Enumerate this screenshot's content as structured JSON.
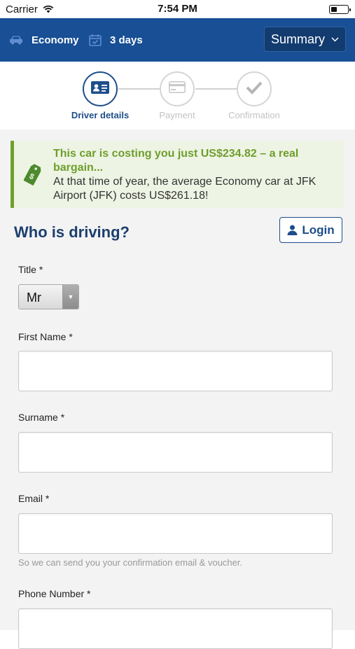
{
  "status_bar": {
    "carrier": "Carrier",
    "time": "7:54 PM"
  },
  "header": {
    "car_class": "Economy",
    "duration": "3 days",
    "summary_label": "Summary"
  },
  "steps": [
    {
      "label": "Driver details",
      "icon": "id-card-icon",
      "active": true
    },
    {
      "label": "Payment",
      "icon": "credit-card-icon",
      "active": false
    },
    {
      "label": "Confirmation",
      "icon": "checkmark-icon",
      "active": false
    }
  ],
  "deal": {
    "title": "This car is costing you just US$234.82 – a real bargain...",
    "text": "At that time of year, the average Economy car at JFK Airport (JFK) costs US$261.18!",
    "icon": "price-tag-icon"
  },
  "form": {
    "heading": "Who is driving?",
    "login_label": "Login",
    "title_label": "Title *",
    "title_value": "Mr",
    "first_name_label": "First Name *",
    "first_name_value": "",
    "surname_label": "Surname *",
    "surname_value": "",
    "email_label": "Email *",
    "email_value": "",
    "email_hint": "So we can send you your confirmation email & voucher.",
    "phone_label": "Phone Number *",
    "phone_value": ""
  },
  "colors": {
    "header_bg": "#184f95",
    "heading_blue": "#1c3f6e",
    "deal_green": "#6e9e2c"
  }
}
